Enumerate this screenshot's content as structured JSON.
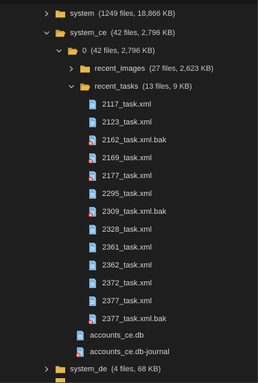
{
  "tree": {
    "system": {
      "name": "system",
      "meta": "(1249 files, 18,866 KB)"
    },
    "system_ce": {
      "name": "system_ce",
      "meta": "(42 files, 2,796 KB)"
    },
    "folder_0": {
      "name": "0",
      "meta": "(42 files, 2,796 KB)"
    },
    "recent_images": {
      "name": "recent_images",
      "meta": "(27 files, 2,623 KB)"
    },
    "recent_tasks": {
      "name": "recent_tasks",
      "meta": "(13 files, 9 KB)"
    },
    "task_files": [
      {
        "name": "2117_task.xml",
        "type": "xml"
      },
      {
        "name": "2123_task.xml",
        "type": "xml"
      },
      {
        "name": "2162_task.xml.bak",
        "type": "bak"
      },
      {
        "name": "2169_task.xml",
        "type": "xml-bad"
      },
      {
        "name": "2177_task.xml",
        "type": "xml-bad"
      },
      {
        "name": "2295_task.xml",
        "type": "xml"
      },
      {
        "name": "2309_task.xml.bak",
        "type": "bak"
      },
      {
        "name": "2328_task.xml",
        "type": "xml"
      },
      {
        "name": "2361_task.xml",
        "type": "xml"
      },
      {
        "name": "2362_task.xml",
        "type": "xml"
      },
      {
        "name": "2372_task.xml",
        "type": "xml"
      },
      {
        "name": "2377_task.xml",
        "type": "xml"
      },
      {
        "name": "2377_task.xml.bak",
        "type": "bak"
      }
    ],
    "accounts_files": [
      {
        "name": "accounts_ce.db",
        "type": "db"
      },
      {
        "name": "accounts_ce.db-journal",
        "type": "bak"
      }
    ],
    "system_de": {
      "name": "system_de",
      "meta": "(4 files, 68 KB)"
    }
  },
  "icons": {
    "chevron_collapsed": "chevron-right-icon",
    "chevron_expanded": "chevron-down-icon",
    "folder": "folder-icon",
    "folder_open": "folder-open-icon",
    "file": "file-icon",
    "file_bak": "file-error-icon"
  },
  "colors": {
    "background": "#1e1e1e",
    "folder": "#e8b84a",
    "file": "#7fb3e0",
    "error_badge": "#e0392b",
    "text": "#d6d6d6"
  }
}
